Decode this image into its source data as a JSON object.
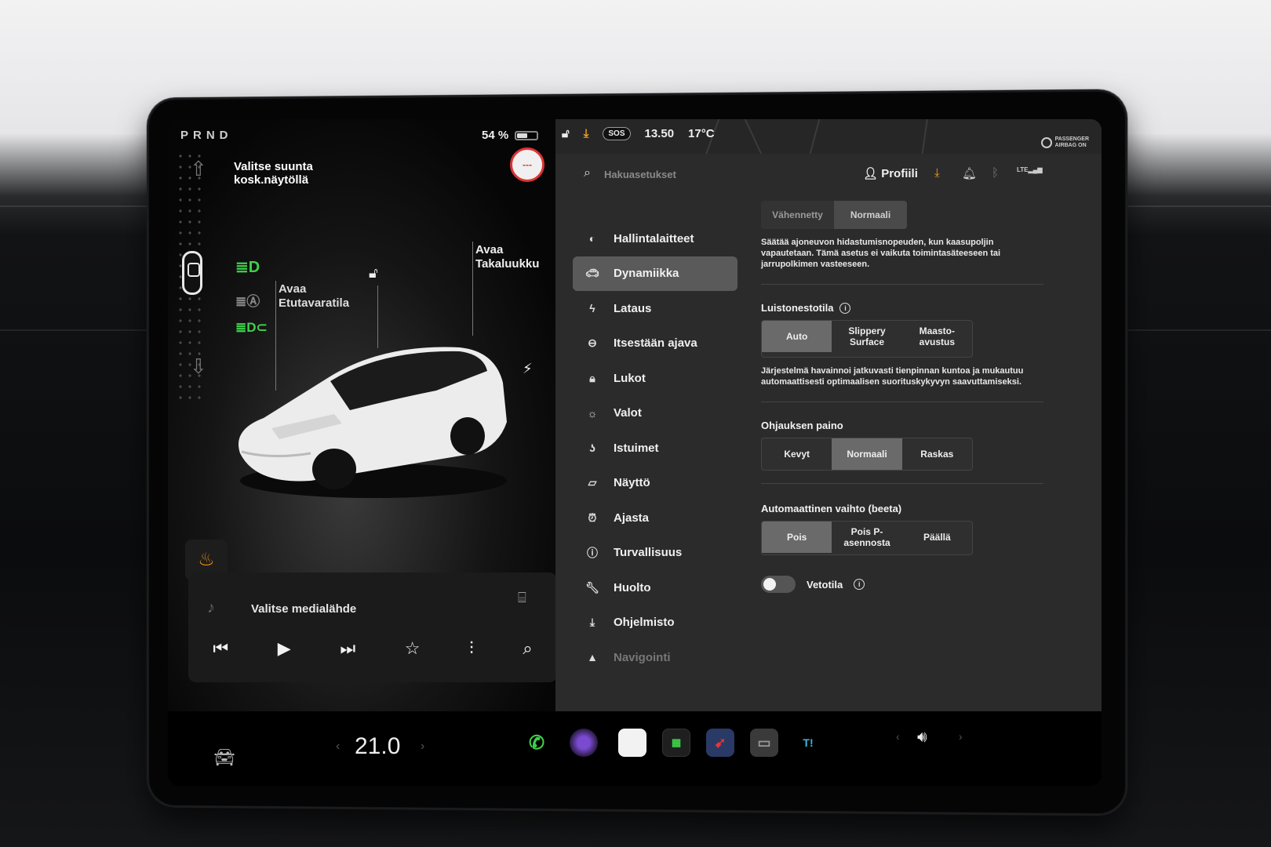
{
  "drive": {
    "gears": "PRND",
    "battery_percent_text": "54 %",
    "battery_level": 0.54,
    "hint": "Valitse suunta kosk.näytöllä",
    "frunk_label_line1": "Avaa",
    "frunk_label_line2": "Etutavaratila",
    "trunk_label_line1": "Avaa",
    "trunk_label_line2": "Takaluukku",
    "sos_badge": "---"
  },
  "media": {
    "title": "Valitse medialähde"
  },
  "status": {
    "sos": "SOS",
    "time": "13.50",
    "temperature": "17°C",
    "airbag_line1": "PASSENGER",
    "airbag_line2": "AIRBAG ON"
  },
  "topbar": {
    "search_placeholder": "Hakuasetukset",
    "profile_label": "Profiili",
    "lte": "LTE"
  },
  "nav": {
    "items": [
      {
        "label": "Hallintalaitteet",
        "icon": "toggle-icon"
      },
      {
        "label": "Dynamiikka",
        "icon": "car-icon"
      },
      {
        "label": "Lataus",
        "icon": "bolt-icon"
      },
      {
        "label": "Itsestään ajava",
        "icon": "steering-wheel-icon"
      },
      {
        "label": "Lukot",
        "icon": "lock-icon"
      },
      {
        "label": "Valot",
        "icon": "sun-icon"
      },
      {
        "label": "Istuimet",
        "icon": "seat-icon"
      },
      {
        "label": "Näyttö",
        "icon": "display-icon"
      },
      {
        "label": "Ajasta",
        "icon": "alarm-icon"
      },
      {
        "label": "Turvallisuus",
        "icon": "info-icon"
      },
      {
        "label": "Huolto",
        "icon": "wrench-icon"
      },
      {
        "label": "Ohjelmisto",
        "icon": "download-icon"
      },
      {
        "label": "Navigointi",
        "icon": "navigation-icon"
      }
    ]
  },
  "content": {
    "regen": {
      "options": [
        "Vähennetty",
        "Normaali"
      ],
      "selected": "Normaali",
      "desc": "Säätää ajoneuvon hidastumisnopeuden, kun kaasupoljin vapautetaan. Tämä asetus ei vaikuta toimintasäteeseen tai jarrupolkimen vasteeseen."
    },
    "traction": {
      "title": "Luistonestotila",
      "options": [
        "Auto",
        "Slippery Surface",
        "Maasto-avustus"
      ],
      "selected": "Auto",
      "desc": "Järjestelmä havainnoi jatkuvasti tienpinnan kuntoa ja mukautuu automaattisesti optimaalisen suorituskykyvyn saavuttamiseksi."
    },
    "steering": {
      "title": "Ohjauksen paino",
      "options": [
        "Kevyt",
        "Normaali",
        "Raskas"
      ],
      "selected": "Normaali"
    },
    "autoshift": {
      "title": "Automaattinen vaihto (beeta)",
      "options": [
        "Pois",
        "Pois P-asennosta",
        "Päällä"
      ],
      "selected": "Pois"
    },
    "tow": {
      "title": "Vetotila",
      "on": false
    }
  },
  "dock": {
    "temperature": "21.0"
  },
  "colors": {
    "headlight_green": "#3fd14a",
    "seat_orange": "#e98b1a",
    "download_orange": "#f0a020",
    "alert_red": "#d33333",
    "selected_segment": "#6a6a6a"
  }
}
